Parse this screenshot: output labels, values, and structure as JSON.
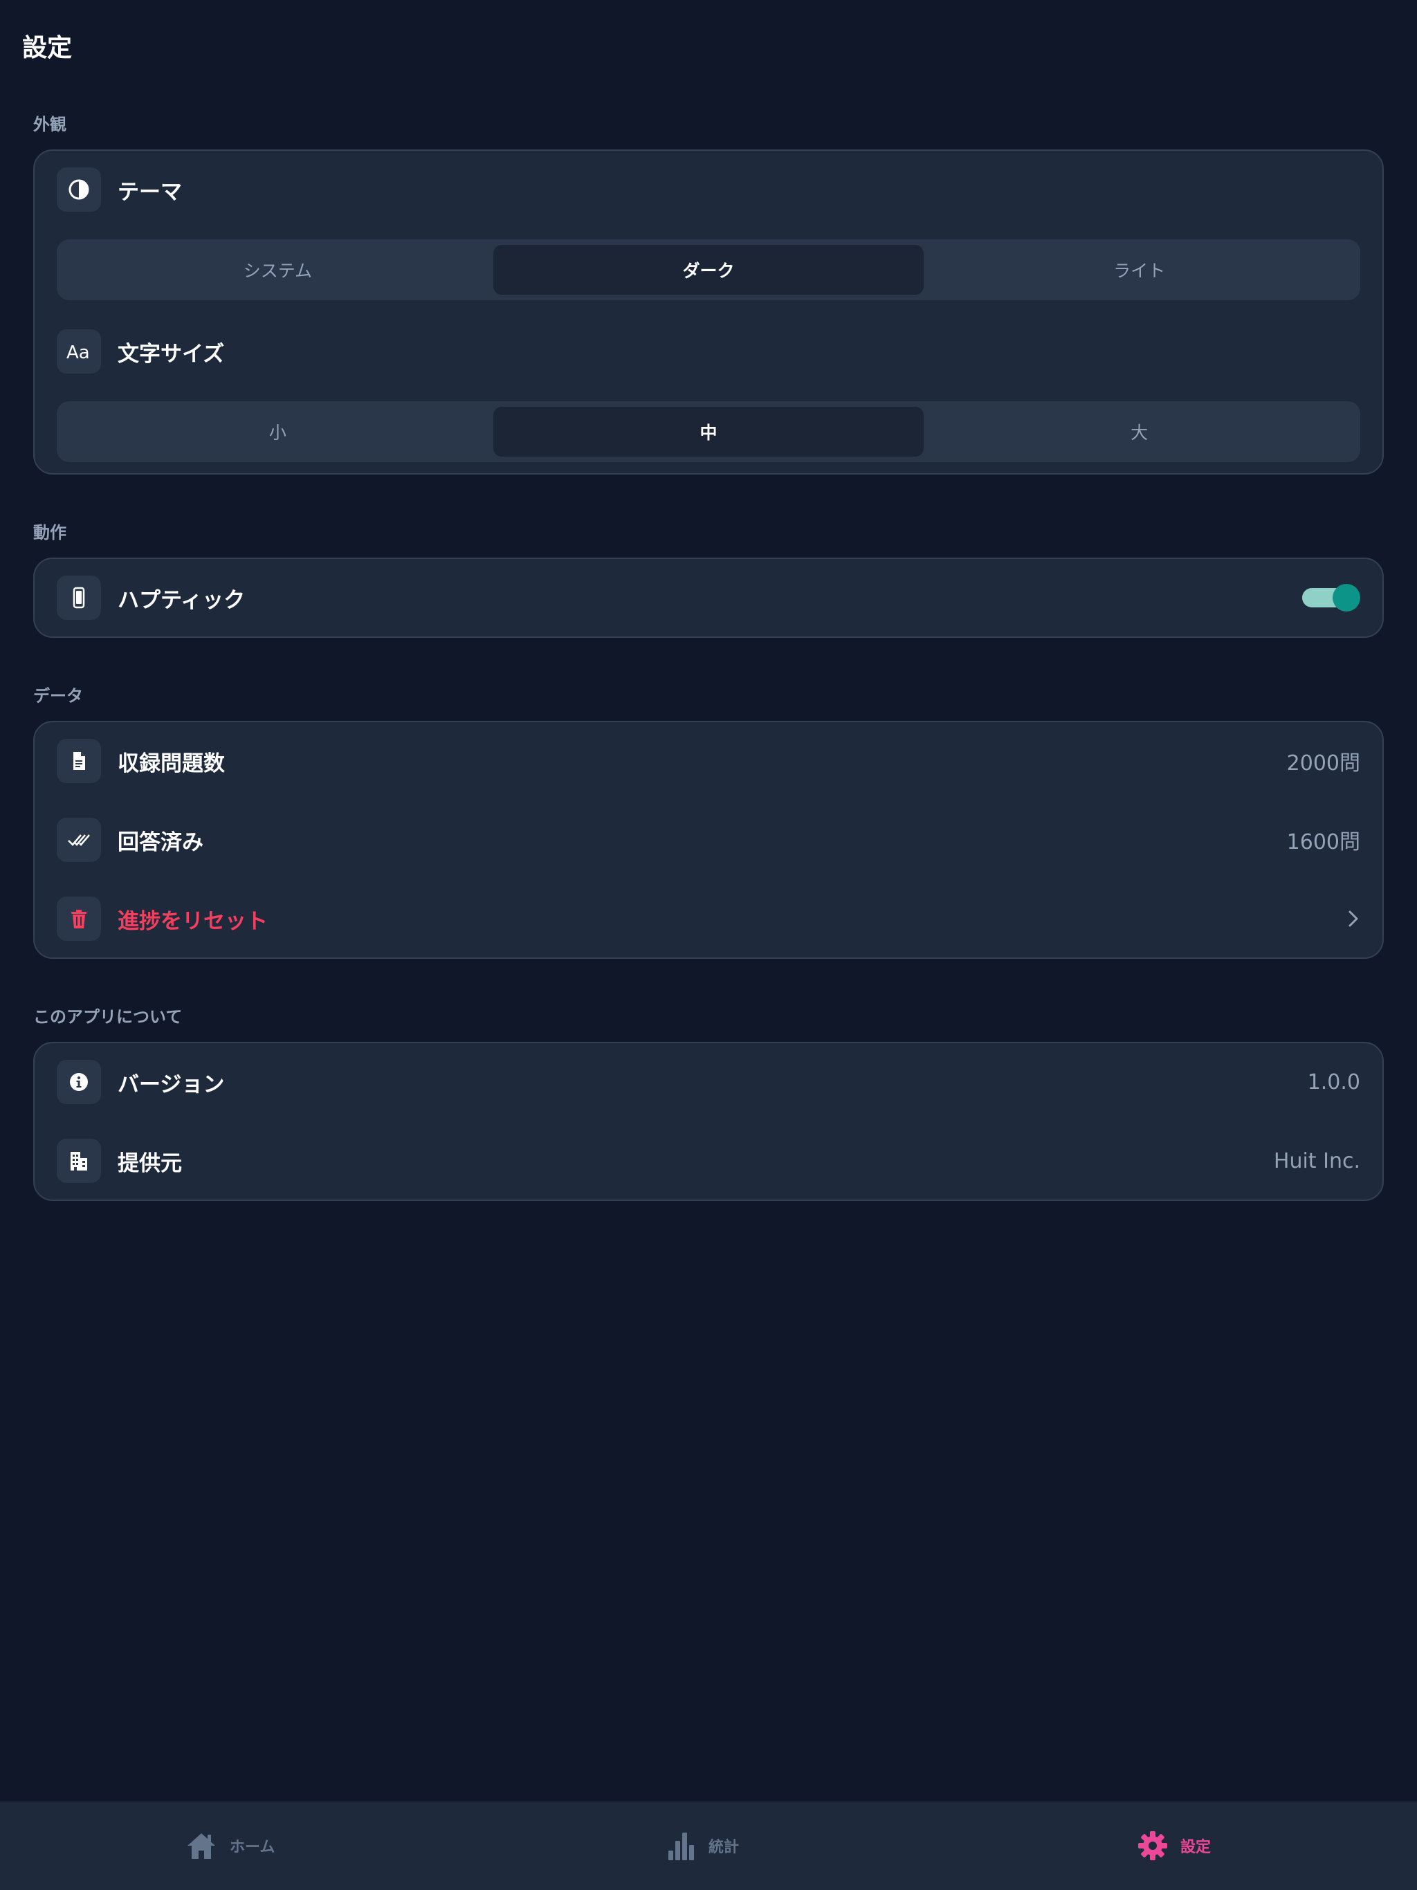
{
  "header": {
    "title": "設定"
  },
  "appearance": {
    "section_title": "外観",
    "theme": {
      "label": "テーマ",
      "icon": "contrast-icon",
      "options": [
        "システム",
        "ダーク",
        "ライト"
      ],
      "selected": "ダーク"
    },
    "font_size": {
      "label": "文字サイズ",
      "icon": "text-size-icon",
      "options": [
        "小",
        "中",
        "大"
      ],
      "selected": "中"
    }
  },
  "behavior": {
    "section_title": "動作",
    "haptics": {
      "label": "ハプティック",
      "icon": "phone-icon",
      "enabled": true
    }
  },
  "data_section": {
    "section_title": "データ",
    "questions": {
      "label": "収録問題数",
      "value": "2000問",
      "icon": "document-icon"
    },
    "answered": {
      "label": "回答済み",
      "value": "1600問",
      "icon": "double-check-icon"
    },
    "reset": {
      "label": "進捗をリセット",
      "icon": "trash-icon"
    }
  },
  "about": {
    "section_title": "このアプリについて",
    "version": {
      "label": "バージョン",
      "value": "1.0.0",
      "icon": "info-icon"
    },
    "provider": {
      "label": "提供元",
      "value": "Huit Inc.",
      "icon": "building-icon"
    }
  },
  "tabbar": {
    "items": [
      {
        "label": "ホーム",
        "icon": "home-icon"
      },
      {
        "label": "統計",
        "icon": "bar-chart-icon"
      },
      {
        "label": "設定",
        "icon": "gear-icon"
      }
    ],
    "active": "設定"
  },
  "colors": {
    "background": "#0f1729",
    "card": "#1e293b",
    "danger": "#f43f5e",
    "toggle_on": "#0d9488",
    "tab_active": "#ec4899",
    "tab_inactive": "#64748b"
  }
}
